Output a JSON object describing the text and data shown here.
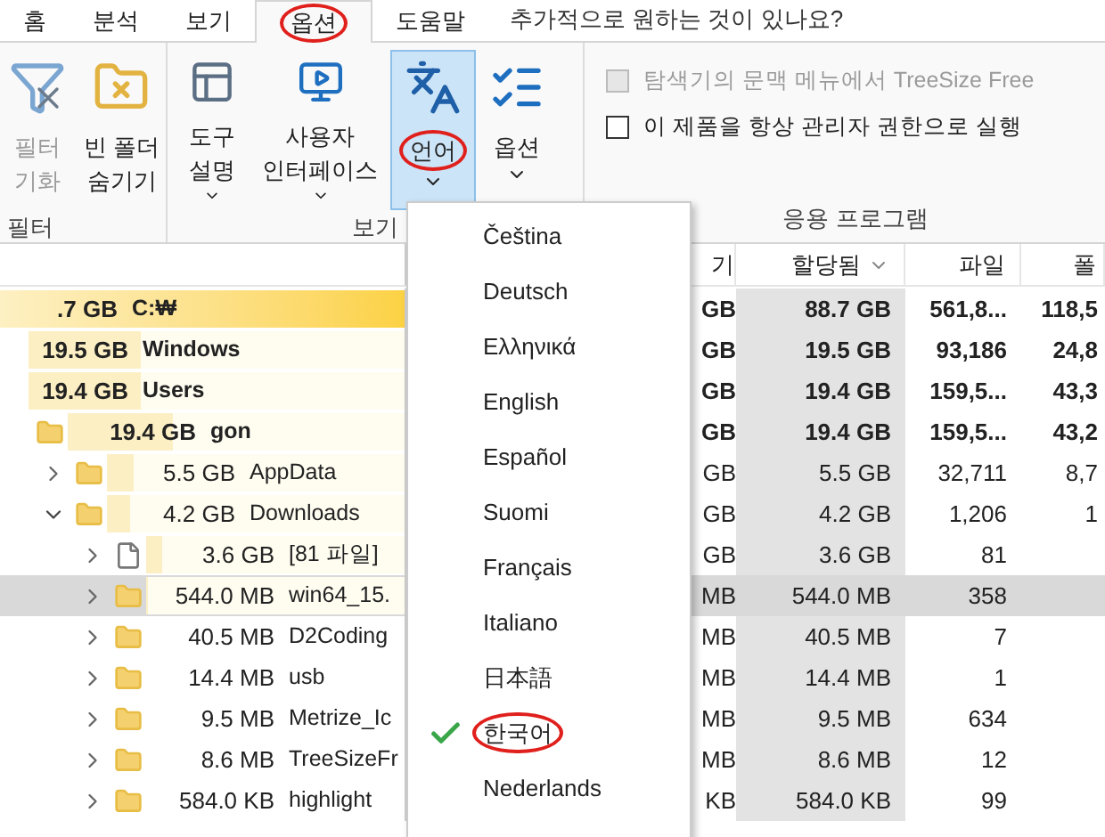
{
  "tabs": [
    {
      "label": "홈",
      "selected": false,
      "circled": false
    },
    {
      "label": "분석",
      "selected": false,
      "circled": false
    },
    {
      "label": "보기",
      "selected": false,
      "circled": false
    },
    {
      "label": "옵션",
      "selected": true,
      "circled": true
    },
    {
      "label": "도움말",
      "selected": false,
      "circled": false
    }
  ],
  "tell_me": "추가적으로 원하는 것이 있나요?",
  "ribbon": {
    "groups": [
      {
        "label": "필터",
        "buttons": [
          {
            "kind": "filter-reset",
            "lines": [
              "필터",
              "기화"
            ],
            "disabled": true,
            "dropdown": false,
            "pressed": false,
            "circled": false
          },
          {
            "kind": "hide-empty",
            "lines": [
              "빈 폴더",
              "숨기기"
            ],
            "disabled": false,
            "dropdown": false,
            "pressed": false,
            "circled": false
          }
        ]
      },
      {
        "label": "보기",
        "buttons": [
          {
            "kind": "tooltips",
            "lines": [
              "도구",
              "설명"
            ],
            "disabled": false,
            "dropdown": true,
            "pressed": false,
            "circled": false
          },
          {
            "kind": "interface",
            "lines": [
              "사용자",
              "인터페이스"
            ],
            "disabled": false,
            "dropdown": true,
            "pressed": false,
            "circled": false
          },
          {
            "kind": "language",
            "lines": [
              "언어"
            ],
            "disabled": false,
            "dropdown": true,
            "pressed": true,
            "circled": true
          },
          {
            "kind": "options",
            "lines": [
              "옵션"
            ],
            "disabled": false,
            "dropdown": true,
            "pressed": false,
            "circled": false
          }
        ]
      },
      {
        "label": "응용 프로그램",
        "checkboxes": [
          {
            "label": "탐색기의 문맥 메뉴에서 TreeSize Free",
            "checked": false,
            "disabled": true
          },
          {
            "label": "이 제품을 항상 관리자 권한으로 실행",
            "checked": false,
            "disabled": false
          }
        ]
      }
    ]
  },
  "table": {
    "columns": [
      {
        "label": "기",
        "sorted": false
      },
      {
        "label": "할당됨",
        "sorted": true
      },
      {
        "label": "파일",
        "sorted": false
      },
      {
        "label": "폴",
        "sorted": false
      }
    ]
  },
  "tree": [
    {
      "size": ".7 GB",
      "name": "C:₩",
      "bold": true,
      "selected": false,
      "level": 1,
      "cells": [
        "GB",
        "88.7 GB",
        "561,8...",
        "118,5"
      ],
      "children": [
        {
          "size": "19.5 GB",
          "name": "Windows",
          "bold": true,
          "selected": false,
          "level": 0.3,
          "cells": [
            "GB",
            "19.5 GB",
            "93,186",
            "24,8"
          ]
        },
        {
          "size": "19.4 GB",
          "name": "Users",
          "bold": true,
          "selected": false,
          "level": 0.3,
          "cells": [
            "GB",
            "19.4 GB",
            "159,5...",
            "43,3"
          ],
          "children": [
            {
              "size": "19.4 GB",
              "name": "gon",
              "kind": "folder",
              "bold": true,
              "selected": false,
              "level": 0.31,
              "cells": [
                "GB",
                "19.4 GB",
                "159,5...",
                "43,2"
              ],
              "children": [
                {
                  "size": "5.5 GB",
                  "name": "AppData",
                  "kind": "folder",
                  "bold": false,
                  "selected": false,
                  "expanded": false,
                  "level": 0.09,
                  "cells": [
                    "GB",
                    "5.5 GB",
                    "32,711",
                    "8,7"
                  ]
                },
                {
                  "size": "4.2 GB",
                  "name": "Downloads",
                  "kind": "folder",
                  "bold": false,
                  "selected": false,
                  "expanded": true,
                  "level": 0.08,
                  "cells": [
                    "GB",
                    "4.2 GB",
                    "1,206",
                    "1"
                  ],
                  "children": [
                    {
                      "size": "3.6 GB",
                      "name": "[81 파일]",
                      "kind": "file",
                      "bold": false,
                      "selected": false,
                      "expanded": false,
                      "level": 0.06,
                      "cells": [
                        "GB",
                        "3.6 GB",
                        "81"
                      ]
                    },
                    {
                      "size": "544.0 MB",
                      "name": "win64_15.",
                      "kind": "folder",
                      "bold": false,
                      "selected": true,
                      "expanded": false,
                      "level": 0.01,
                      "cells": [
                        "MB",
                        "544.0 MB",
                        "358"
                      ]
                    },
                    {
                      "size": "40.5 MB",
                      "name": "D2Coding",
                      "kind": "folder",
                      "bold": false,
                      "selected": false,
                      "expanded": false,
                      "cells": [
                        "MB",
                        "40.5 MB",
                        "7"
                      ]
                    },
                    {
                      "size": "14.4 MB",
                      "name": "usb",
                      "kind": "folder",
                      "bold": false,
                      "selected": false,
                      "expanded": false,
                      "cells": [
                        "MB",
                        "14.4 MB",
                        "1"
                      ]
                    },
                    {
                      "size": "9.5 MB",
                      "name": "Metrize_Ic",
                      "kind": "folder",
                      "bold": false,
                      "selected": false,
                      "expanded": false,
                      "cells": [
                        "MB",
                        "9.5 MB",
                        "634"
                      ]
                    },
                    {
                      "size": "8.6 MB",
                      "name": "TreeSizeFr",
                      "kind": "folder",
                      "bold": false,
                      "selected": false,
                      "expanded": false,
                      "cells": [
                        "MB",
                        "8.6 MB",
                        "12"
                      ]
                    },
                    {
                      "size": "584.0 KB",
                      "name": "highlight",
                      "kind": "folder",
                      "bold": false,
                      "selected": false,
                      "expanded": false,
                      "cells": [
                        "KB",
                        "584.0 KB",
                        "99"
                      ]
                    }
                  ]
                }
              ]
            }
          ]
        }
      ]
    }
  ],
  "language_menu": [
    {
      "label": "Čeština",
      "selected": false,
      "circled": false
    },
    {
      "label": "Deutsch",
      "selected": false,
      "circled": false
    },
    {
      "label": "Ελληνικά",
      "selected": false,
      "circled": false
    },
    {
      "label": "English",
      "selected": false,
      "circled": false
    },
    {
      "label": "Español",
      "selected": false,
      "circled": false
    },
    {
      "label": "Suomi",
      "selected": false,
      "circled": false
    },
    {
      "label": "Français",
      "selected": false,
      "circled": false
    },
    {
      "label": "Italiano",
      "selected": false,
      "circled": false
    },
    {
      "label": "日本語",
      "selected": false,
      "circled": false
    },
    {
      "label": "한국어",
      "selected": true,
      "circled": true
    },
    {
      "label": "Nederlands",
      "selected": false,
      "circled": false
    }
  ]
}
